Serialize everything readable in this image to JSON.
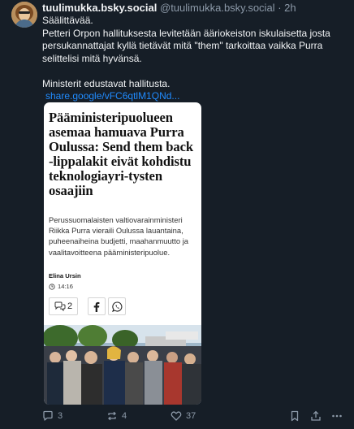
{
  "post": {
    "display_name": "tuulimukka.bsky.social",
    "handle": "@tuulimukka.bsky.social",
    "separator": "·",
    "time": "2h",
    "text_lines": [
      "Säälittävää.",
      "Petteri Orpon hallituksesta levitetään ääriokeiston iskulaisetta josta persukannattajat kyllä tietävät mitä \"them\" tarkoittaa vaikka Purra selittelisi mitä hyvänsä.",
      "",
      "Ministerit edustavat hallitusta."
    ],
    "link_text": "share.google/vFC6qtlM1QNd..."
  },
  "card": {
    "headline": "Pääministeripuolueen asemaa hamuava Purra Oulussa: Send them back -lippalakit eivät kohdistu teknologiayri-tysten osaajiin",
    "lede": "Perussuomalaisten valtiovarainministeri Riikka Purra vieraili Oulussa lauantaina, puheenaiheina budjetti, maahanmuutto ja vaalitavoitteena pääministeripuolue.",
    "author": "Elina Ursin",
    "time": "14:16",
    "comment_count": "2"
  },
  "footer": {
    "replies": "3",
    "reposts": "4",
    "likes": "37"
  },
  "icons": {
    "reply": "reply-icon",
    "repost": "repost-icon",
    "like": "heart-icon",
    "bookmark": "bookmark-icon",
    "share": "share-icon",
    "more": "more-icon"
  },
  "colors": {
    "background": "#161e27",
    "link": "#208bfe",
    "muted": "#8c99a8"
  }
}
